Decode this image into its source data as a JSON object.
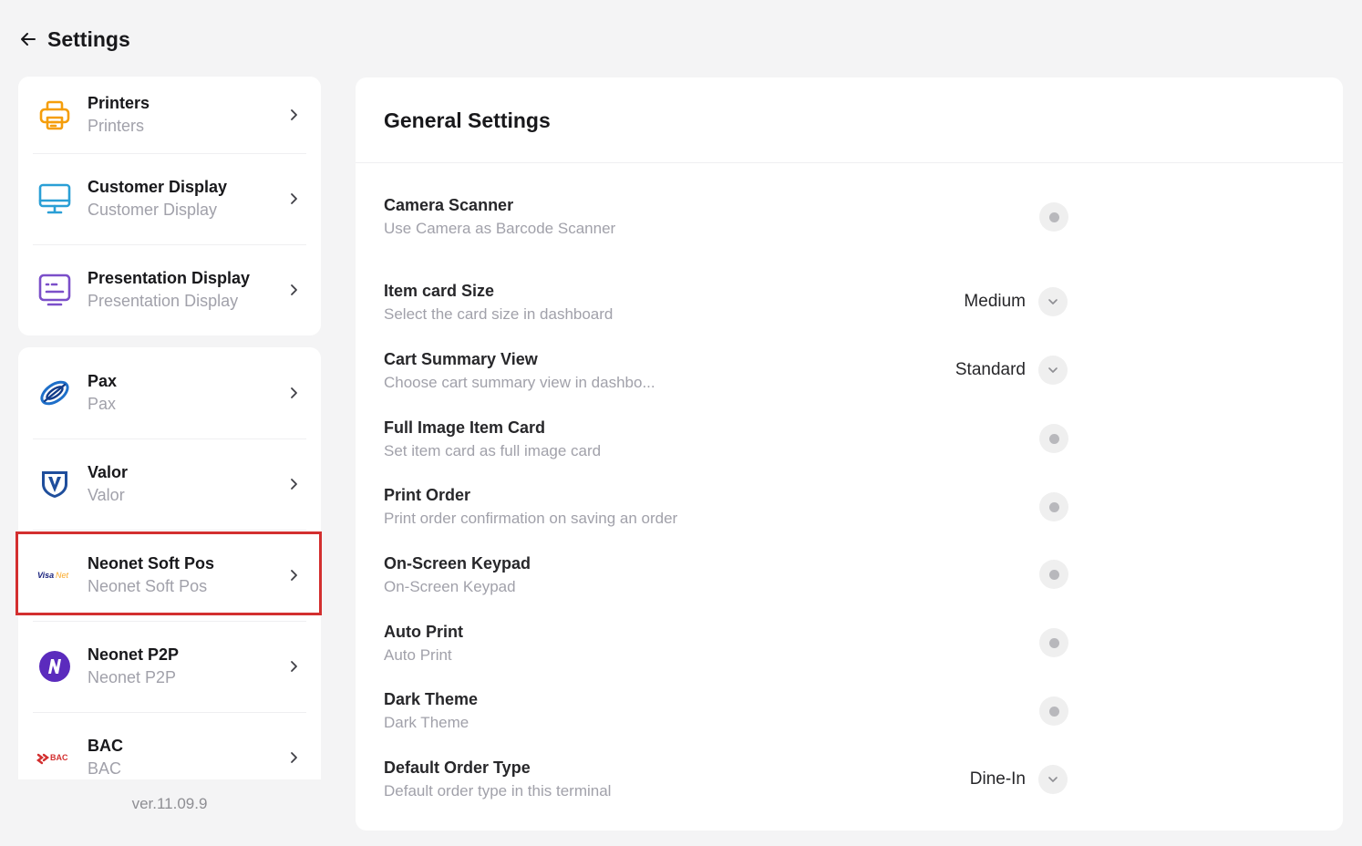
{
  "header": {
    "title": "Settings"
  },
  "sidebar": {
    "group1": [
      {
        "title": "Printers",
        "subtitle": "Printers",
        "icon": "printer-icon"
      },
      {
        "title": "Customer Display",
        "subtitle": "Customer Display",
        "icon": "monitor-icon"
      },
      {
        "title": "Presentation Display",
        "subtitle": "Presentation Display",
        "icon": "presentation-display-icon"
      }
    ],
    "group2": [
      {
        "title": "Pax",
        "subtitle": "Pax",
        "icon": "pax-logo-icon"
      },
      {
        "title": "Valor",
        "subtitle": "Valor",
        "icon": "valor-logo-icon"
      },
      {
        "title": "Neonet Soft Pos",
        "subtitle": "Neonet Soft Pos",
        "icon": "visanet-logo-icon",
        "logo_text": "VisaNet"
      },
      {
        "title": "Neonet P2P",
        "subtitle": "Neonet P2P",
        "icon": "neonet-logo-icon"
      },
      {
        "title": "BAC",
        "subtitle": "BAC",
        "icon": "bac-logo-icon",
        "logo_text": "BAC"
      }
    ]
  },
  "version": "ver.11.09.9",
  "main": {
    "title": "General Settings",
    "settings": [
      {
        "title": "Camera Scanner",
        "subtitle": "Use Camera as Barcode Scanner",
        "control": "toggle"
      },
      {
        "title": "Item card Size",
        "subtitle": "Select the card size in dashboard",
        "control": "dropdown",
        "value": "Medium"
      },
      {
        "title": "Cart Summary View",
        "subtitle": "Choose cart summary view in dashbo...",
        "control": "dropdown",
        "value": "Standard"
      },
      {
        "title": "Full Image Item Card",
        "subtitle": "Set item card as full image card",
        "control": "toggle"
      },
      {
        "title": "Print Order",
        "subtitle": "Print order confirmation on saving an order",
        "control": "toggle"
      },
      {
        "title": "On-Screen Keypad",
        "subtitle": "On-Screen Keypad",
        "control": "toggle"
      },
      {
        "title": "Auto Print",
        "subtitle": "Auto Print",
        "control": "toggle"
      },
      {
        "title": "Dark Theme",
        "subtitle": "Dark Theme",
        "control": "toggle"
      },
      {
        "title": "Default Order Type",
        "subtitle": "Default order type in this terminal",
        "control": "dropdown",
        "value": "Dine-In"
      }
    ]
  },
  "colors": {
    "accent_highlight": "#d32f2f",
    "printer_icon": "#f59e0b",
    "monitor_icon": "#2a9fd6",
    "presentation_icon": "#7b4fc9",
    "neonet_logo": "#5b2bbd"
  }
}
